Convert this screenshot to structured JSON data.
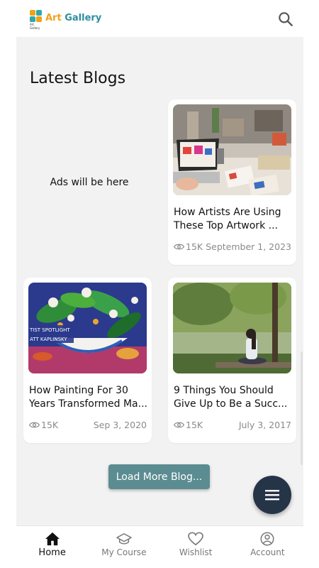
{
  "app": {
    "logo_text_a": "Art",
    "logo_text_b": " Gallery",
    "logo_tiny": "Art Gallery"
  },
  "icons": {
    "search": "search-icon",
    "menu": "menu-icon",
    "eye": "eye-icon",
    "home": "home-icon",
    "course": "graduation-cap-icon",
    "wishlist": "heart-icon",
    "account": "account-circle-icon"
  },
  "colors": {
    "accent": "#5b8c91",
    "fab": "#263447",
    "background": "#f2f2f2"
  },
  "section": {
    "title": "Latest Blogs",
    "ad_text": "Ads will be here"
  },
  "posts": [
    {
      "title": "How Artists Are Using These Top Artwork ...",
      "views": "15K",
      "date": "September 1, 2023"
    },
    {
      "title": "How Painting For 30 Years Transformed Ma...",
      "views": "15K",
      "date": "Sep 3, 2020",
      "banner_line1": "TIST SPOTLIGHT",
      "banner_line2": "ATT KAPLINSKY"
    },
    {
      "title": "9 Things You Should Give Up to Be a Succ...",
      "views": "15K",
      "date": "July 3, 2017"
    }
  ],
  "actions": {
    "load_more": "Load More Blog..."
  },
  "nav": [
    {
      "label": "Home",
      "active": true
    },
    {
      "label": "My Course",
      "active": false
    },
    {
      "label": "Wishlist",
      "active": false
    },
    {
      "label": "Account",
      "active": false
    }
  ]
}
